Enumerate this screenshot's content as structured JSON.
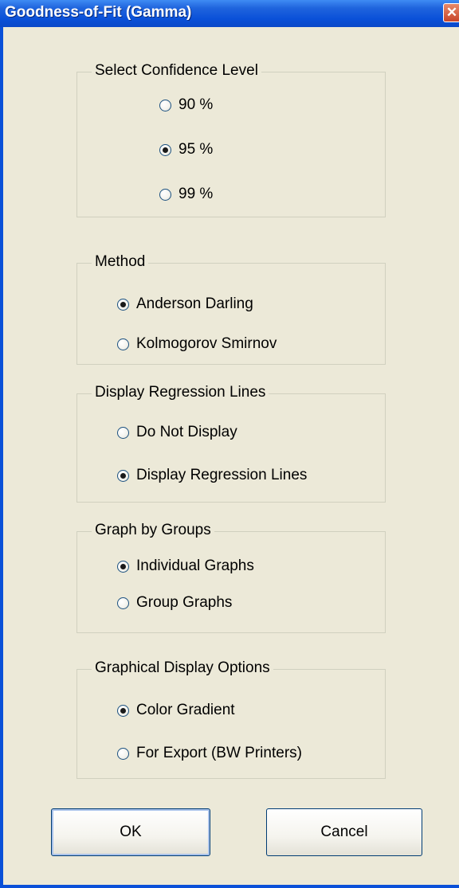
{
  "window": {
    "title": "Goodness-of-Fit (Gamma)",
    "close_glyph": "✕"
  },
  "groups": {
    "confidence": {
      "title": "Select Confidence Level",
      "options": [
        {
          "label": "90 %",
          "checked": false
        },
        {
          "label": "95 %",
          "checked": true
        },
        {
          "label": "99 %",
          "checked": false
        }
      ]
    },
    "method": {
      "title": "Method",
      "options": [
        {
          "label": "Anderson Darling",
          "checked": true
        },
        {
          "label": "Kolmogorov Smirnov",
          "checked": false
        }
      ]
    },
    "regression": {
      "title": "Display Regression Lines",
      "options": [
        {
          "label": "Do Not Display",
          "checked": false
        },
        {
          "label": "Display Regression Lines",
          "checked": true
        }
      ]
    },
    "graph_by_groups": {
      "title": "Graph by Groups",
      "options": [
        {
          "label": "Individual Graphs",
          "checked": true
        },
        {
          "label": "Group Graphs",
          "checked": false
        }
      ]
    },
    "graphical_display": {
      "title": "Graphical Display Options",
      "options": [
        {
          "label": "Color Gradient",
          "checked": true
        },
        {
          "label": "For Export (BW Printers)",
          "checked": false
        }
      ]
    }
  },
  "buttons": {
    "ok": "OK",
    "cancel": "Cancel"
  },
  "colors": {
    "titlebar": "#0a50d8",
    "dialog_bg": "#ece9d8",
    "close_button": "#c8452a"
  },
  "icons": {
    "close": "close-icon",
    "radio": "radio-button"
  }
}
